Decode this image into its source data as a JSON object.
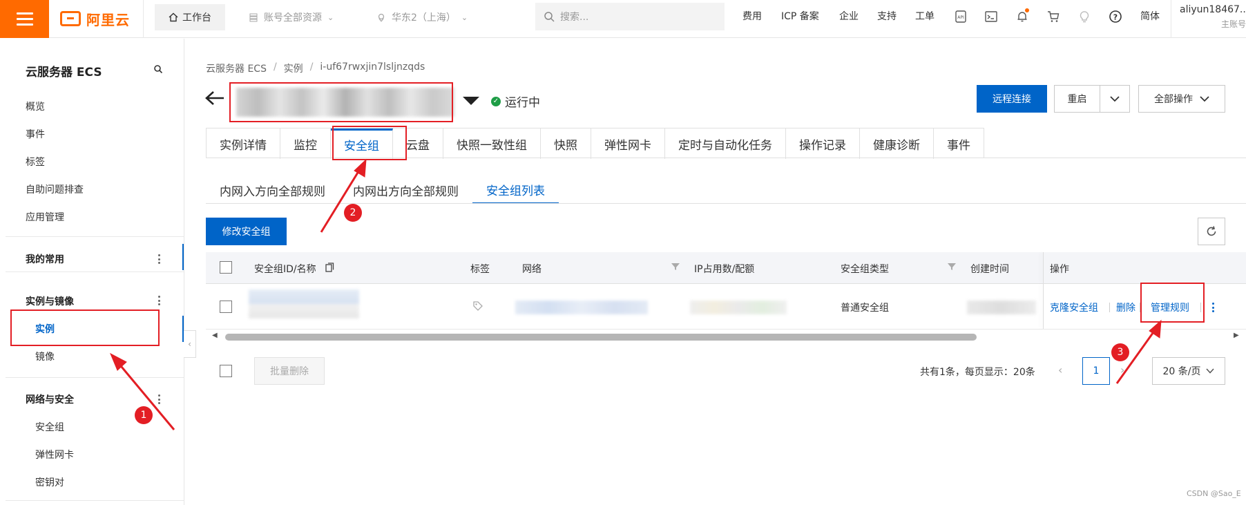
{
  "topbar": {
    "logo_text": "阿里云",
    "workbench": "工作台",
    "resource_select": "账号全部资源",
    "region_select": "华东2（上海）",
    "search_placeholder": "搜索...",
    "links": [
      "费用",
      "ICP 备案",
      "企业",
      "支持",
      "工单"
    ],
    "lang": "简体",
    "account_name": "aliyun18467...",
    "account_sub": "主账号"
  },
  "sidebar": {
    "title": "云服务器 ECS",
    "items": [
      "概览",
      "事件",
      "标签",
      "自助问题排查",
      "应用管理"
    ],
    "favorites": "我的常用",
    "group_instances": {
      "title": "实例与镜像",
      "items": [
        "实例",
        "镜像"
      ]
    },
    "group_network": {
      "title": "网络与安全",
      "items": [
        "安全组",
        "弹性网卡",
        "密钥对"
      ]
    }
  },
  "breadcrumb": [
    "云服务器 ECS",
    "实例",
    "i-uf67rwxjin7lsljnzqds"
  ],
  "instance_status": "运行中",
  "header_buttons": {
    "remote": "远程连接",
    "restart": "重启",
    "all_ops": "全部操作"
  },
  "tabs": [
    "实例详情",
    "监控",
    "安全组",
    "云盘",
    "快照一致性组",
    "快照",
    "弹性网卡",
    "定时与自动化任务",
    "操作记录",
    "健康诊断",
    "事件"
  ],
  "active_tab": "安全组",
  "subtabs": [
    "内网入方向全部规则",
    "内网出方向全部规则",
    "安全组列表"
  ],
  "active_subtab": "安全组列表",
  "modify_button": "修改安全组",
  "table": {
    "headers": {
      "id_name": "安全组ID/名称",
      "tag": "标签",
      "network": "网络",
      "ip_quota": "IP占用数/配额",
      "type": "安全组类型",
      "created": "创建时间",
      "ops": "操作"
    },
    "rows": [
      {
        "type": "普通安全组",
        "ops": [
          "克隆安全组",
          "删除",
          "管理规则"
        ]
      }
    ]
  },
  "batch_delete": "批量删除",
  "pager": {
    "summary": "共有1条，每页显示：20条",
    "current_page": "1",
    "page_size": "20 条/页"
  },
  "annotations": [
    "1",
    "2",
    "3"
  ],
  "watermark": "CSDN @Sao_E",
  "colors": {
    "brand_orange": "#ff6a00",
    "primary_blue": "#0064c8",
    "annotation_red": "#e31e24",
    "status_green": "#1e9d46"
  }
}
